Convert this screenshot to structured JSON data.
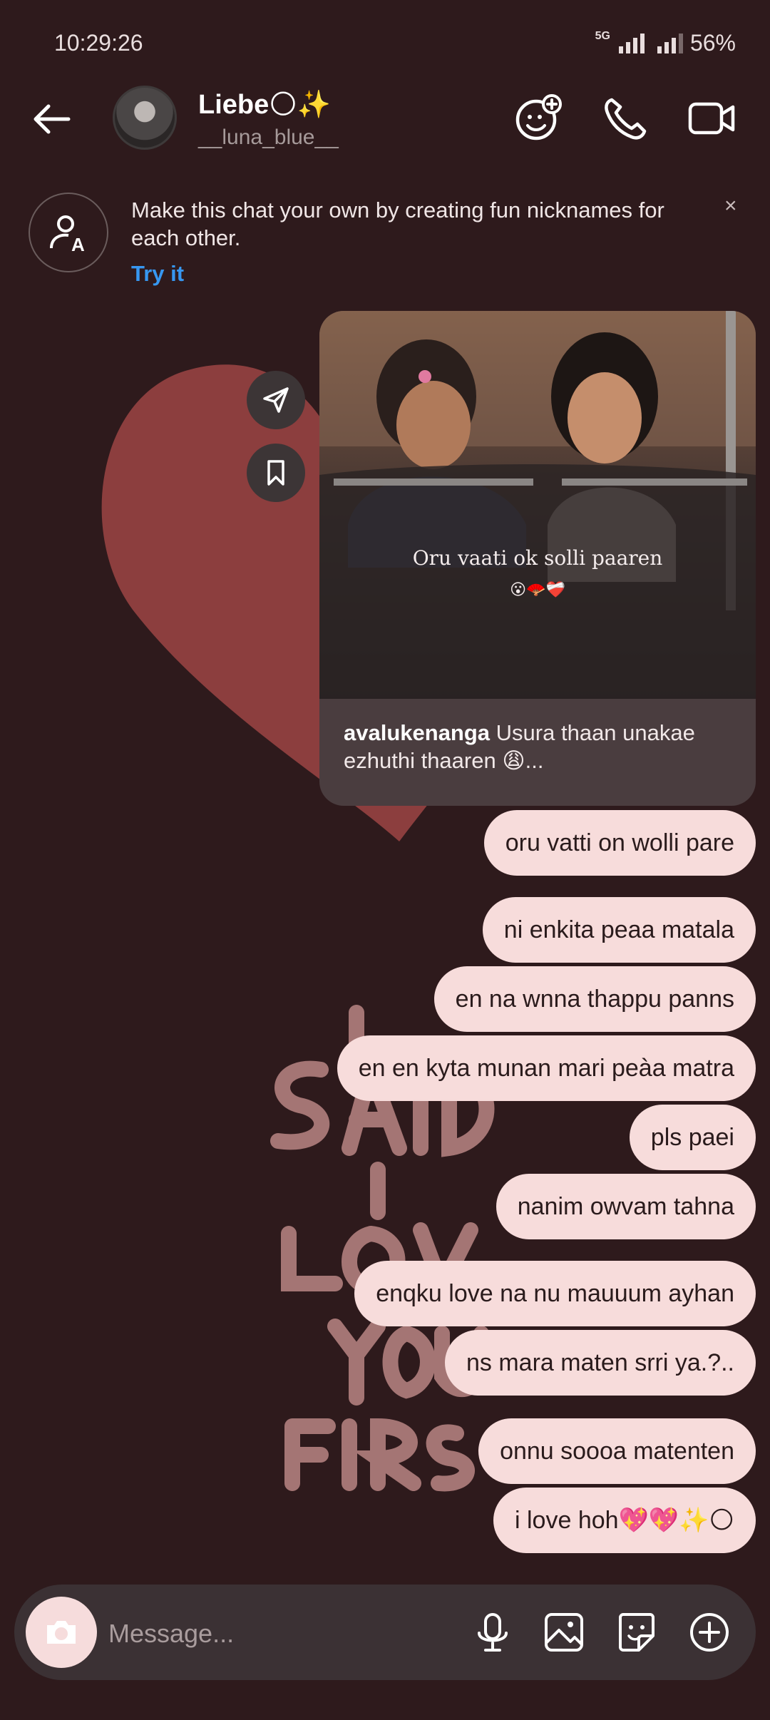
{
  "status_bar": {
    "time": "10:29:26",
    "network": "5G",
    "battery": "56%"
  },
  "header": {
    "contact_name": "Liebe🌕✨",
    "contact_handle": "__luna_blue__",
    "icons": [
      "back-arrow-icon",
      "effects-icon",
      "phone-icon",
      "video-call-icon"
    ]
  },
  "nickname_banner": {
    "text": "Make this chat your own by creating fun nicknames for each other.",
    "action": "Try it",
    "close": "×"
  },
  "shared_post": {
    "image_caption": "Oru vaati ok solli paaren",
    "image_emoji": "😮🪭❤️‍🩹",
    "author": "avalukenanga",
    "caption": "Usura thaan unakae ezhuthi thaaren 😩..."
  },
  "messages": [
    "oru vatti on wolli pare",
    "ni enkita peaa matala",
    "en na wnna thappu panns",
    "en en kyta munan mari peàa matra",
    "pls paei",
    "nanim owvam tahna",
    "enqku love na nu mauuum ayhan",
    "ns mara maten srri ya.?..",
    "onnu soooa matenten",
    "i love hoh💖💖✨🌕"
  ],
  "composer": {
    "placeholder": "Message..."
  },
  "colors": {
    "background": "#2e1a1c",
    "bubble": "#f7dcdb",
    "link": "#3797f0"
  }
}
